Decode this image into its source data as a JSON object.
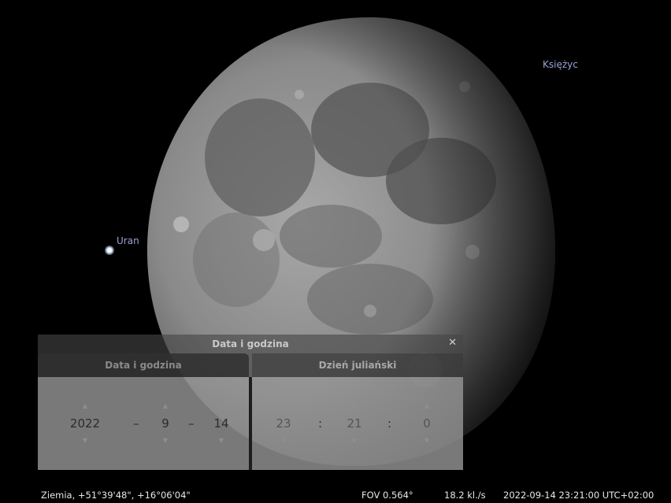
{
  "sky": {
    "labels": {
      "planet": "Uran",
      "moon": "Księżyc"
    }
  },
  "dialog": {
    "title": "Data i godzina",
    "close_icon": "close-icon",
    "tabs": {
      "date": "Data i godzina",
      "julian": "Dzień juliański"
    },
    "date": {
      "year": "2022",
      "month": "9",
      "day": "14",
      "separator": "–"
    },
    "time": {
      "hour": "23",
      "minute": "21",
      "second": "0",
      "separator": ":"
    },
    "spin_up_icon": "spin-up-arrow-icon",
    "spin_down_icon": "spin-down-arrow-icon"
  },
  "status": {
    "location": "Ziemia, +51°39'48\", +16°06'04\"",
    "fov": "FOV 0.564°",
    "fps": "18.2 kl./s",
    "datetime": "2022-09-14 23:21:00 UTC+02:00"
  },
  "colors": {
    "sky": "#000000",
    "label": "#9aa3d6",
    "status_text": "#e8e8e8"
  }
}
